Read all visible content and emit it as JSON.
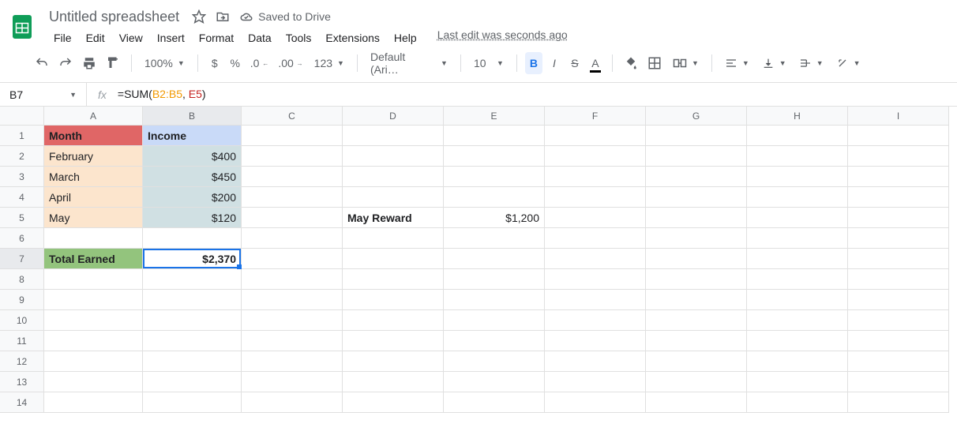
{
  "header": {
    "title": "Untitled spreadsheet",
    "saved": "Saved to Drive",
    "lastEdit": "Last edit was seconds ago"
  },
  "menus": [
    "File",
    "Edit",
    "View",
    "Insert",
    "Format",
    "Data",
    "Tools",
    "Extensions",
    "Help"
  ],
  "toolbar": {
    "zoom": "100%",
    "font": "Default (Ari…",
    "fontSize": "10",
    "numFmt": "123"
  },
  "formulaBar": {
    "nameBox": "B7",
    "formulaPrefix": "=SUM(",
    "ref1": "B2:B5",
    "sep": ", ",
    "ref2": "E5",
    "suffix": ")"
  },
  "columns": [
    "A",
    "B",
    "C",
    "D",
    "E",
    "F",
    "G",
    "H",
    "I"
  ],
  "rows": [
    "1",
    "2",
    "3",
    "4",
    "5",
    "6",
    "7",
    "8",
    "9",
    "10",
    "11",
    "12",
    "13",
    "14"
  ],
  "sheet": {
    "A1": "Month",
    "B1": "Income",
    "A2": "February",
    "B2": "$400",
    "A3": "March",
    "B3": "$450",
    "A4": "April",
    "B4": "$200",
    "A5": "May",
    "B5": "$120",
    "D5": "May Reward",
    "E5": "$1,200",
    "A7": "Total Earned",
    "B7": "$2,370"
  },
  "activeCell": "B7"
}
